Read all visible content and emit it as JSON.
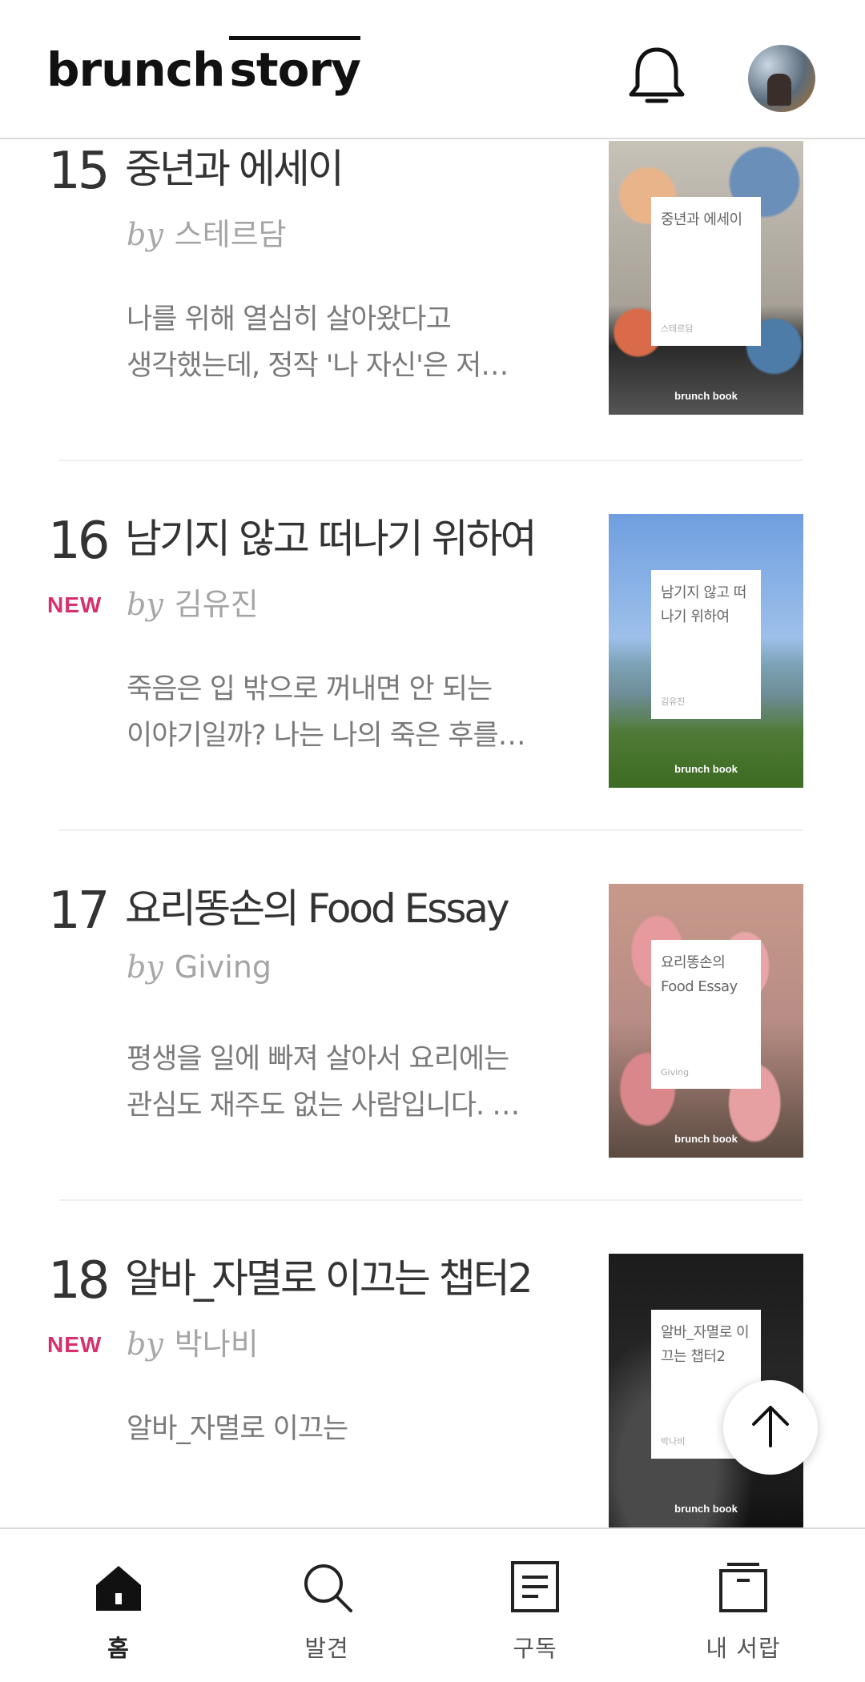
{
  "header": {
    "logo_word1": "brunch",
    "logo_word2": "story",
    "notification_icon": "bell-icon",
    "profile_icon": "avatar"
  },
  "items": [
    {
      "rank": "15",
      "badge": "",
      "title": "중년과 에세이",
      "by": "by",
      "author": "스테르담",
      "desc_line1": "나를 위해 열심히 살아왔다고",
      "desc_line2": "생각했는데, 정작 '나 자신'은 저…",
      "cover_title": "중년과 에세이",
      "cover_author": "스테르담",
      "cover_brand": "brunch book"
    },
    {
      "rank": "16",
      "badge": "NEW",
      "title": "남기지 않고 떠나기 위하여",
      "by": "by",
      "author": "김유진",
      "desc_line1": "죽음은 입 밖으로 꺼내면 안 되는",
      "desc_line2": "이야기일까? 나는 나의 죽은 후를…",
      "cover_title": "남기지 않고 떠나기 위하여",
      "cover_author": "김유진",
      "cover_brand": "brunch book"
    },
    {
      "rank": "17",
      "badge": "",
      "title": "요리똥손의 Food Essay",
      "by": "by",
      "author": "Giving",
      "desc_line1": "평생을 일에 빠져 살아서 요리에는",
      "desc_line2": "관심도 재주도 없는 사람입니다. …",
      "cover_title": "요리똥손의 Food Essay",
      "cover_author": "Giving",
      "cover_brand": "brunch book"
    },
    {
      "rank": "18",
      "badge": "NEW",
      "title": "알바_자멸로 이끄는 챕터2",
      "by": "by",
      "author": "박나비",
      "desc_line1": "알바_자멸로 이끄는",
      "desc_line2": "",
      "cover_title": "알바_자멸로 이끄는 챕터2",
      "cover_author": "박나비",
      "cover_brand": "brunch book"
    }
  ],
  "scroll_top_icon": "arrow-up-icon",
  "tabbar": {
    "tabs": [
      {
        "label": "홈",
        "icon": "home-icon",
        "active": true
      },
      {
        "label": "발견",
        "icon": "search-icon",
        "active": false
      },
      {
        "label": "구독",
        "icon": "document-icon",
        "active": false
      },
      {
        "label": "내 서랍",
        "icon": "drawer-icon",
        "active": false
      }
    ]
  }
}
